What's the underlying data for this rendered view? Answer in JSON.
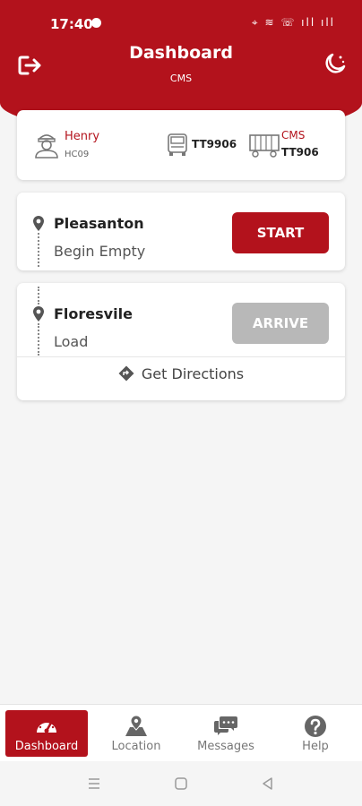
{
  "status_bar": {
    "time": "17:40",
    "icons": "⌖ ≋ ☏ ıll ıll"
  },
  "header": {
    "title": "Dashboard",
    "subtitle": "CMS",
    "logout_icon": "logout-icon",
    "theme_icon": "moon-icon"
  },
  "assignment": {
    "driver_name": "Henry",
    "driver_id": "HC09",
    "truck_id": "TT9906",
    "trailer_company": "CMS",
    "trailer_id": "TT906"
  },
  "stops": [
    {
      "name": "Pleasanton",
      "type": "Begin Empty",
      "action": "START"
    },
    {
      "name": "Floresvile",
      "type": "Load",
      "action": "ARRIVE",
      "directions": "Get Directions"
    }
  ],
  "nav": [
    {
      "label": "Dashboard",
      "icon": "speedometer-icon"
    },
    {
      "label": "Location",
      "icon": "map-pin-icon"
    },
    {
      "label": "Messages",
      "icon": "chat-icon"
    },
    {
      "label": "Help",
      "icon": "help-icon"
    }
  ],
  "colors": {
    "primary": "#b3121c",
    "disabled": "#b8b8b8",
    "background": "#f5f5f5"
  }
}
